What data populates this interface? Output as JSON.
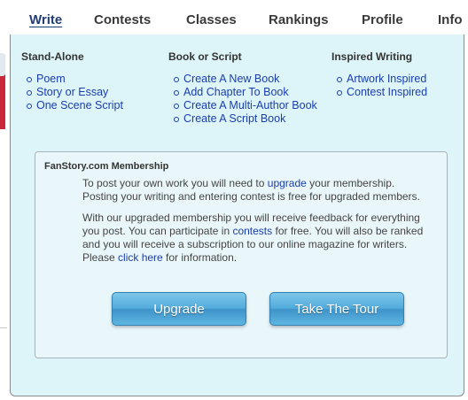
{
  "nav": {
    "write": "Write",
    "contests": "Contests",
    "classes": "Classes",
    "rankings": "Rankings",
    "profile": "Profile",
    "info": "Info"
  },
  "columns": {
    "standalone": {
      "heading": "Stand-Alone",
      "items": [
        "Poem",
        "Story or Essay",
        "One Scene Script"
      ]
    },
    "book": {
      "heading": "Book or Script",
      "items": [
        "Create A New Book",
        "Add Chapter To Book",
        "Create A Multi-Author Book",
        "Create A Script Book"
      ]
    },
    "inspired": {
      "heading": "Inspired Writing",
      "items": [
        "Artwork Inspired",
        "Contest Inspired"
      ]
    }
  },
  "membership": {
    "title": "FanStory.com Membership",
    "p1": {
      "l1_pre": "To post your own work you will need to ",
      "l1_link": "upgrade",
      "l1_post": " your membership.",
      "l2": "Posting your writing and entering contest is free for upgraded members."
    },
    "p2": {
      "l1": "With our upgraded membership you will receive feedback for everything",
      "l2_pre": "you post. You can participate in ",
      "l2_link": "contests",
      "l2_post": " for free. You will also be ranked",
      "l3": "and you will receive a subscription to our online magazine for writers.",
      "l4_pre": "Please ",
      "l4_link": "click here",
      "l4_post": " for information."
    },
    "upgrade_button": "Upgrade",
    "tour_button": "Take The Tour"
  },
  "colors": {
    "panel_bg": "#ddf5f9",
    "link": "#1a3db0",
    "active_nav": "#233c74",
    "button": "#52abdb"
  }
}
